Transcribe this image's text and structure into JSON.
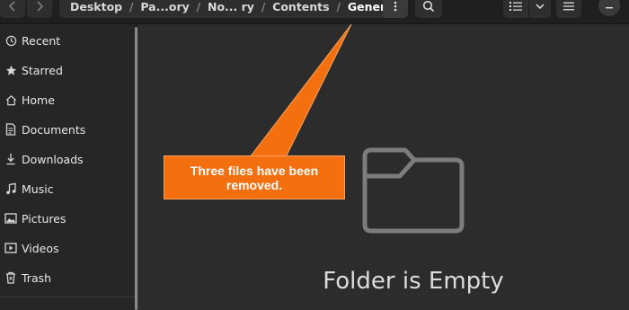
{
  "breadcrumb": {
    "items": [
      "Desktop",
      "Pa...ory",
      "No... ry",
      "Contents"
    ],
    "current": "General",
    "separator": "/"
  },
  "sidebar": {
    "items": [
      {
        "label": "Recent",
        "icon": "clock-icon"
      },
      {
        "label": "Starred",
        "icon": "star-icon"
      },
      {
        "label": "Home",
        "icon": "home-icon"
      },
      {
        "label": "Documents",
        "icon": "document-icon"
      },
      {
        "label": "Downloads",
        "icon": "download-icon"
      },
      {
        "label": "Music",
        "icon": "music-icon"
      },
      {
        "label": "Pictures",
        "icon": "picture-icon"
      },
      {
        "label": "Videos",
        "icon": "video-icon"
      },
      {
        "label": "Trash",
        "icon": "trash-icon"
      }
    ]
  },
  "main": {
    "empty_label": "Folder is Empty"
  },
  "annotation": {
    "text": "Three files have been removed.",
    "color": "#f46f0f"
  }
}
